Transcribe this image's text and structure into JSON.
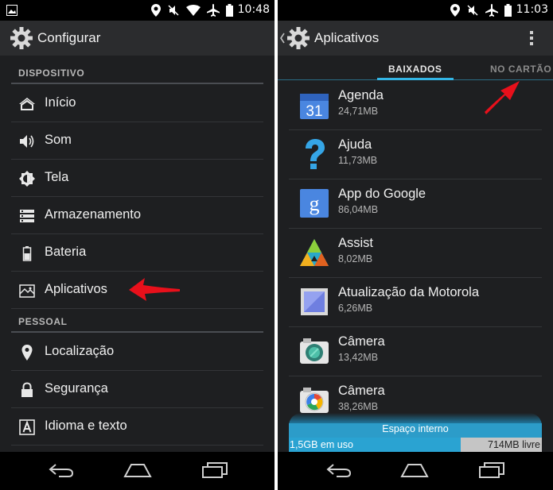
{
  "left": {
    "status": {
      "time": "10:48"
    },
    "title": "Configurar",
    "sections": [
      {
        "header": "DISPOSITIVO",
        "items": [
          {
            "label": "Início",
            "icon": "home-icon"
          },
          {
            "label": "Som",
            "icon": "volume-icon"
          },
          {
            "label": "Tela",
            "icon": "brightness-icon"
          },
          {
            "label": "Armazenamento",
            "icon": "storage-icon"
          },
          {
            "label": "Bateria",
            "icon": "battery-icon"
          },
          {
            "label": "Aplicativos",
            "icon": "apps-icon"
          }
        ]
      },
      {
        "header": "PESSOAL",
        "items": [
          {
            "label": "Localização",
            "icon": "location-icon"
          },
          {
            "label": "Segurança",
            "icon": "lock-icon"
          },
          {
            "label": "Idioma e texto",
            "icon": "language-icon"
          }
        ]
      }
    ]
  },
  "right": {
    "status": {
      "time": "11:03"
    },
    "title": "Aplicativos",
    "tabs": [
      {
        "label": "BAIXADOS",
        "active": true
      },
      {
        "label": "NO CARTÃO",
        "active": false
      }
    ],
    "apps": [
      {
        "name": "Agenda",
        "size": "24,71MB",
        "icon": "calendar-icon"
      },
      {
        "name": "Ajuda",
        "size": "11,73MB",
        "icon": "help-icon"
      },
      {
        "name": "App do Google",
        "size": "86,04MB",
        "icon": "google-icon"
      },
      {
        "name": "Assist",
        "size": "8,02MB",
        "icon": "assist-icon"
      },
      {
        "name": "Atualização da Motorola",
        "size": "6,26MB",
        "icon": "motorola-update-icon"
      },
      {
        "name": "Câmera",
        "size": "13,42MB",
        "icon": "camera-icon"
      },
      {
        "name": "Câmera",
        "size": "38,26MB",
        "icon": "camera-icon"
      }
    ],
    "calendar_day": "31",
    "storage": {
      "title": "Espaço interno",
      "used": "1,5GB em uso",
      "free": "714MB livre"
    }
  },
  "colors": {
    "accent": "#33b5e5",
    "annotation": "#e8101b",
    "background": "#1e1f21"
  }
}
